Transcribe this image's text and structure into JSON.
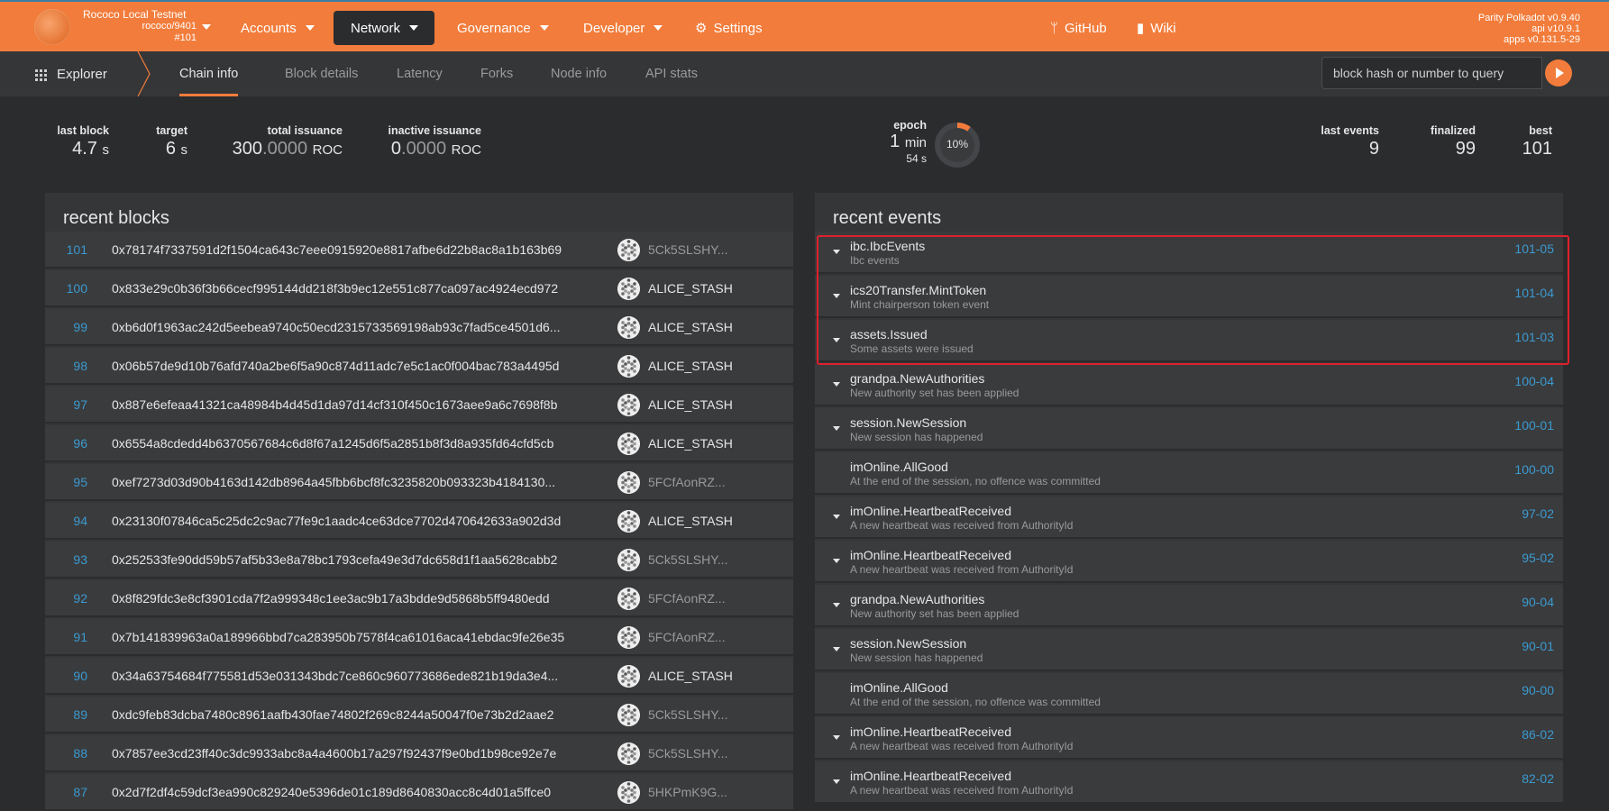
{
  "top": {
    "chain_name": "Rococo Local Testnet",
    "chain_spec": "rococo/9401",
    "chain_block": "#101",
    "menu": [
      {
        "label": "Accounts",
        "active": false
      },
      {
        "label": "Network",
        "active": true
      },
      {
        "label": "Governance",
        "active": false
      },
      {
        "label": "Developer",
        "active": false
      },
      {
        "label": "Settings",
        "active": false
      }
    ],
    "github": "GitHub",
    "wiki": "Wiki",
    "version_node": "Parity Polkadot v0.9.40",
    "version_api": "api v10.9.1",
    "version_apps": "apps v0.131.5-29",
    "accent": "#f27c3b"
  },
  "subnav": {
    "explorer": "Explorer",
    "tabs": [
      "Chain info",
      "Block details",
      "Latency",
      "Forks",
      "Node info",
      "API stats"
    ],
    "active_tab": "Chain info",
    "query_placeholder": "block hash or number to query"
  },
  "summary": {
    "last_block_label": "last block",
    "last_block_value": "4.7",
    "last_block_unit": "s",
    "target_label": "target",
    "target_value": "6",
    "target_unit": "s",
    "total_issuance_label": "total issuance",
    "total_issuance_int": "300",
    "total_issuance_dec": ".0000",
    "total_issuance_unit": "ROC",
    "inactive_issuance_label": "inactive issuance",
    "inactive_issuance_int": "0",
    "inactive_issuance_dec": ".0000",
    "inactive_issuance_unit": "ROC",
    "epoch_label": "epoch",
    "epoch_value": "1",
    "epoch_unit": "min",
    "epoch_sub": "54 s",
    "epoch_percent": "10%",
    "epoch_fraction": 0.1,
    "last_events_label": "last events",
    "last_events_value": "9",
    "finalized_label": "finalized",
    "finalized_value": "99",
    "best_label": "best",
    "best_value": "101"
  },
  "recent_blocks": {
    "title": "recent blocks",
    "rows": [
      {
        "num": "101",
        "hash": "0x78174f7337591d2f1504ca643c7eee0915920e8817afbe6d22b8ac8a1b163b69",
        "author": "5Ck5SLSHY...",
        "dim": true
      },
      {
        "num": "100",
        "hash": "0x833e29c0b36f3b66cecf995144dd218f3b9ec12e551c877ca097ac4924ecd972",
        "author": "ALICE_STASH",
        "dim": false
      },
      {
        "num": "99",
        "hash": "0xb6d0f1963ac242d5eebea9740c50ecd2315733569198ab93c7fad5ce4501d6...",
        "author": "ALICE_STASH",
        "dim": false
      },
      {
        "num": "98",
        "hash": "0x06b57de9d10b76afd740a2be6f5a90c874d11adc7e5c1ac0f004bac783a4495d",
        "author": "ALICE_STASH",
        "dim": false
      },
      {
        "num": "97",
        "hash": "0x887e6efeaa41321ca48984b4d45d1da97d14cf310f450c1673aee9a6c7698f8b",
        "author": "ALICE_STASH",
        "dim": false
      },
      {
        "num": "96",
        "hash": "0x6554a8cdedd4b6370567684c6d8f67a1245d6f5a2851b8f3d8a935fd64cfd5cb",
        "author": "ALICE_STASH",
        "dim": false
      },
      {
        "num": "95",
        "hash": "0xef7273d03d90b4163d142db8964a45fbb6bcf8fc3235820b093323b4184130...",
        "author": "5FCfAonRZ...",
        "dim": true
      },
      {
        "num": "94",
        "hash": "0x23130f07846ca5c25dc2c9ac77fe9c1aadc4ce63dce7702d470642633a902d3d",
        "author": "ALICE_STASH",
        "dim": false
      },
      {
        "num": "93",
        "hash": "0x252533fe90dd59b57af5b33e8a78bc1793cefa49e3d7dc658d1f1aa5628cabb2",
        "author": "5Ck5SLSHY...",
        "dim": true
      },
      {
        "num": "92",
        "hash": "0x8f829fdc3e8cf3901cda7f2a999348c1ee3ac9b17a3bdde9d5868b5ff9480edd",
        "author": "5FCfAonRZ...",
        "dim": true
      },
      {
        "num": "91",
        "hash": "0x7b141839963a0a189966bbd7ca283950b7578f4ca61016aca41ebdac9fe26e35",
        "author": "5FCfAonRZ...",
        "dim": true
      },
      {
        "num": "90",
        "hash": "0x34a63754684f775581d53e031343bdc7ce860c960773686ede821b19da3e4...",
        "author": "ALICE_STASH",
        "dim": false
      },
      {
        "num": "89",
        "hash": "0xdc9feb83dcba7480c8961aafb430fae74802f269c8244a50047f0e73b2d2aae2",
        "author": "5Ck5SLSHY...",
        "dim": true
      },
      {
        "num": "88",
        "hash": "0x7857ee3cd23ff40c3dc9933abc8a4a4600b17a297f92437f9e0bd1b98ce92e7e",
        "author": "5Ck5SLSHY...",
        "dim": true
      },
      {
        "num": "87",
        "hash": "0x2d7f2df4c59dcf3ea990c829240e5396de01c189d8640830acc8c4d01a5ffce0",
        "author": "5HKPmK9G...",
        "dim": true
      }
    ]
  },
  "recent_events": {
    "title": "recent events",
    "rows": [
      {
        "name": "ibc.IbcEvents",
        "desc": "Ibc events",
        "id": "101-05",
        "expandable": true
      },
      {
        "name": "ics20Transfer.MintToken",
        "desc": "Mint chairperson token event",
        "id": "101-04",
        "expandable": true
      },
      {
        "name": "assets.Issued",
        "desc": "Some assets were issued",
        "id": "101-03",
        "expandable": true
      },
      {
        "name": "grandpa.NewAuthorities",
        "desc": "New authority set has been applied",
        "id": "100-04",
        "expandable": true
      },
      {
        "name": "session.NewSession",
        "desc": "New session has happened",
        "id": "100-01",
        "expandable": true
      },
      {
        "name": "imOnline.AllGood",
        "desc": "At the end of the session, no offence was committed",
        "id": "100-00",
        "expandable": false
      },
      {
        "name": "imOnline.HeartbeatReceived",
        "desc": "A new heartbeat was received from AuthorityId",
        "id": "97-02",
        "expandable": true
      },
      {
        "name": "imOnline.HeartbeatReceived",
        "desc": "A new heartbeat was received from AuthorityId",
        "id": "95-02",
        "expandable": true
      },
      {
        "name": "grandpa.NewAuthorities",
        "desc": "New authority set has been applied",
        "id": "90-04",
        "expandable": true
      },
      {
        "name": "session.NewSession",
        "desc": "New session has happened",
        "id": "90-01",
        "expandable": true
      },
      {
        "name": "imOnline.AllGood",
        "desc": "At the end of the session, no offence was committed",
        "id": "90-00",
        "expandable": false
      },
      {
        "name": "imOnline.HeartbeatReceived",
        "desc": "A new heartbeat was received from AuthorityId",
        "id": "86-02",
        "expandable": true
      },
      {
        "name": "imOnline.HeartbeatReceived",
        "desc": "A new heartbeat was received from AuthorityId",
        "id": "82-02",
        "expandable": true
      }
    ]
  }
}
